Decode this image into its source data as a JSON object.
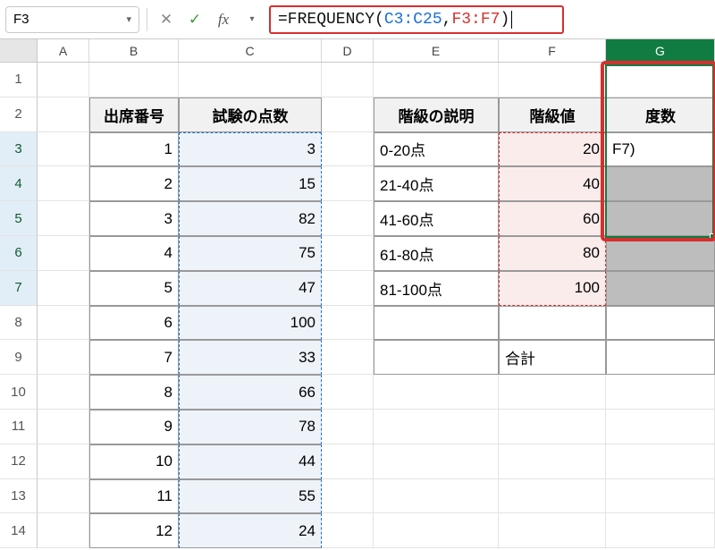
{
  "namebox": {
    "value": "F3"
  },
  "formula": {
    "prefix": "=FREQUENCY(",
    "ref1": "C3:C25",
    "comma": ",",
    "ref2": "F3:F7",
    "suffix": ")"
  },
  "columns": [
    "A",
    "B",
    "C",
    "D",
    "E",
    "F",
    "G"
  ],
  "rows": [
    "1",
    "2",
    "3",
    "4",
    "5",
    "6",
    "7",
    "8",
    "9",
    "10",
    "11",
    "12",
    "13",
    "14"
  ],
  "headers": {
    "B": "出席番号",
    "C": "試験の点数",
    "E": "階級の説明",
    "F": "階級値",
    "G": "度数"
  },
  "colB": [
    "1",
    "2",
    "3",
    "4",
    "5",
    "6",
    "7",
    "8",
    "9",
    "10",
    "11",
    "12"
  ],
  "colC": [
    "3",
    "15",
    "82",
    "75",
    "47",
    "100",
    "33",
    "66",
    "78",
    "44",
    "55",
    "24"
  ],
  "colE": [
    "0-20点",
    "21-40点",
    "41-60点",
    "61-80点",
    "81-100点"
  ],
  "colF": [
    "20",
    "40",
    "60",
    "80",
    "100"
  ],
  "G3": "F7)",
  "F9": "合計"
}
